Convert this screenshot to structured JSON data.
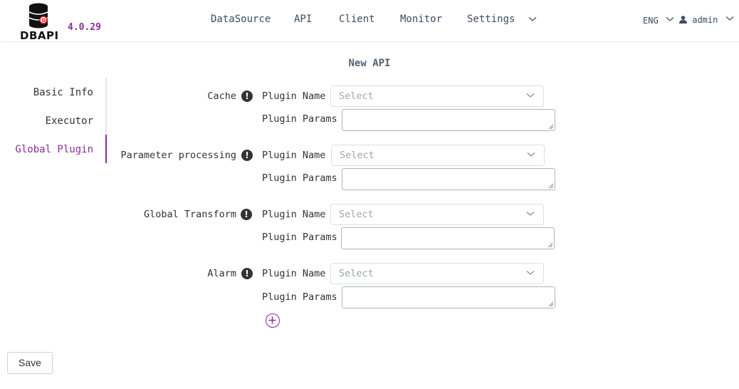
{
  "header": {
    "logo_text": "DBAPI",
    "version": "4.0.29",
    "nav": [
      "DataSource",
      "API",
      "Client",
      "Monitor",
      "Settings"
    ],
    "language": "ENG",
    "user": "admin"
  },
  "page": {
    "title": "New API",
    "steps": [
      "Basic Info",
      "Executor",
      "Global Plugin"
    ],
    "active_step": "Global Plugin"
  },
  "plugins": [
    {
      "label": "Cache",
      "name_label": "Plugin Name",
      "params_label": "Plugin Params",
      "placeholder": "Select"
    },
    {
      "label": "Parameter processing",
      "name_label": "Plugin Name",
      "params_label": "Plugin Params",
      "placeholder": "Select"
    },
    {
      "label": "Global Transform",
      "name_label": "Plugin Name",
      "params_label": "Plugin Params",
      "placeholder": "Select"
    },
    {
      "label": "Alarm",
      "name_label": "Plugin Name",
      "params_label": "Plugin Params",
      "placeholder": "Select"
    }
  ],
  "actions": {
    "save": "Save"
  },
  "colors": {
    "accent": "#8a2d9a",
    "nav_text": "#3d4c63"
  }
}
